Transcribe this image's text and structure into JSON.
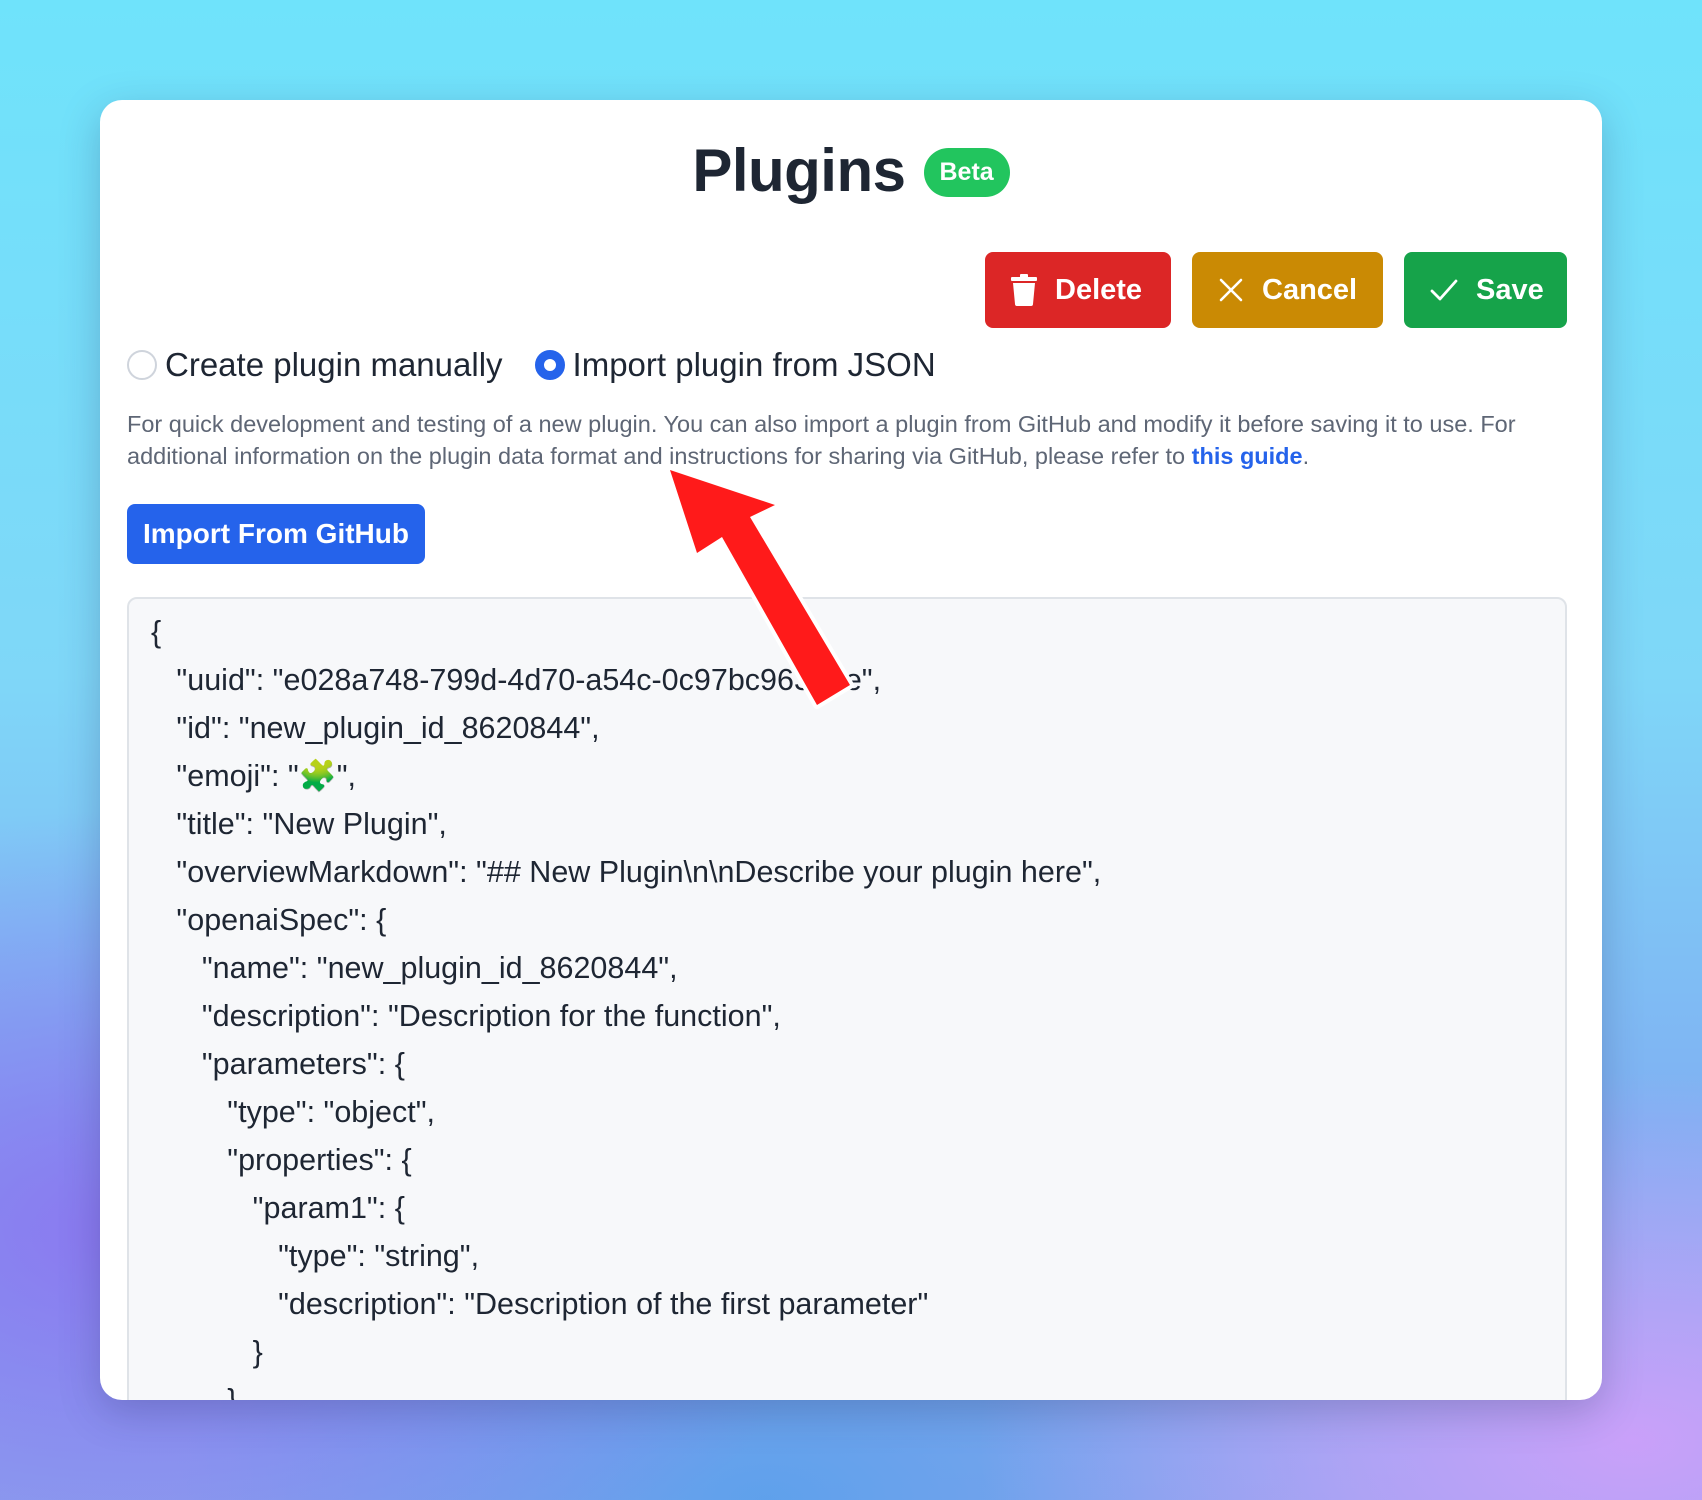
{
  "header": {
    "title": "Plugins",
    "badge": "Beta"
  },
  "toolbar": {
    "delete_label": "Delete",
    "cancel_label": "Cancel",
    "save_label": "Save"
  },
  "mode": {
    "options": [
      {
        "label": "Create plugin manually",
        "selected": false
      },
      {
        "label": "Import plugin from JSON",
        "selected": true
      }
    ]
  },
  "help": {
    "text": "For quick development and testing of a new plugin. You can also import a plugin from GitHub and modify it before saving it to use. For additional information on the plugin data format and instructions for sharing via GitHub, please refer to ",
    "link_text": "this guide",
    "suffix": "."
  },
  "import_button": {
    "label": "Import From GitHub"
  },
  "editor": {
    "lines": [
      "{",
      "   \"uuid\": \"e028a748-799d-4d70-a54c-0c97bc96327e\",",
      "   \"id\": \"new_plugin_id_8620844\",",
      "   \"emoji\": \"🧩\",",
      "   \"title\": \"New Plugin\",",
      "   \"overviewMarkdown\": \"## New Plugin\\n\\nDescribe your plugin here\",",
      "   \"openaiSpec\": {",
      "      \"name\": \"new_plugin_id_8620844\",",
      "      \"description\": \"Description for the function\",",
      "      \"parameters\": {",
      "         \"type\": \"object\",",
      "         \"properties\": {",
      "            \"param1\": {",
      "               \"type\": \"string\",",
      "               \"description\": \"Description of the first parameter\"",
      "            }",
      "         }"
    ]
  },
  "colors": {
    "delete": "#dc2626",
    "cancel": "#ca8a04",
    "save": "#16a34a",
    "primary": "#2563eb",
    "badge": "#22c55e",
    "annotation_arrow": "#ff1a1a"
  }
}
